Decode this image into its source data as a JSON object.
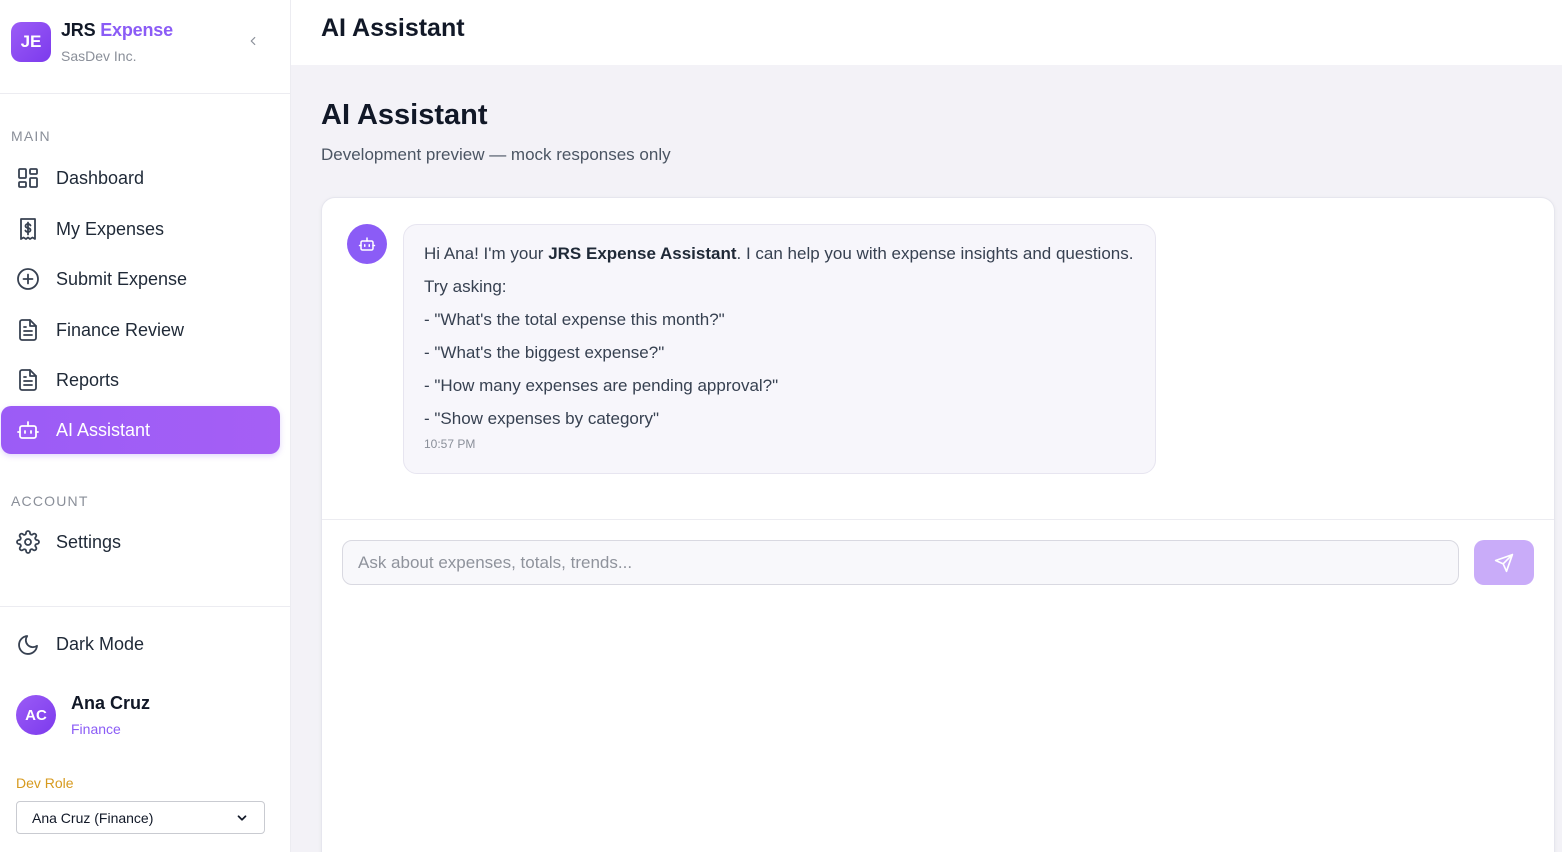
{
  "brand": {
    "initials": "JE",
    "name_part1": "JRS",
    "name_part2": "Expense",
    "company": "SasDev Inc."
  },
  "sidebar": {
    "main_label": "MAIN",
    "items": [
      {
        "label": "Dashboard",
        "icon": "dashboard-icon"
      },
      {
        "label": "My Expenses",
        "icon": "receipt-dollar-icon"
      },
      {
        "label": "Submit Expense",
        "icon": "plus-circle-icon"
      },
      {
        "label": "Finance Review",
        "icon": "document-icon"
      },
      {
        "label": "Reports",
        "icon": "document-icon"
      },
      {
        "label": "AI Assistant",
        "icon": "bot-icon",
        "active": true
      }
    ],
    "account_label": "ACCOUNT",
    "account_items": [
      {
        "label": "Settings",
        "icon": "gear-icon"
      }
    ],
    "dark_mode_label": "Dark Mode"
  },
  "user": {
    "initials": "AC",
    "name": "Ana Cruz",
    "role": "Finance"
  },
  "dev_role": {
    "label": "Dev Role",
    "selected": "Ana Cruz (Finance)"
  },
  "topbar": {
    "title": "AI Assistant"
  },
  "page": {
    "title": "AI Assistant",
    "subtitle": "Development preview — mock responses only"
  },
  "chat": {
    "message": {
      "greeting_pre": "Hi Ana! I'm your ",
      "greeting_bold": "JRS Expense Assistant",
      "greeting_post": ". I can help you with expense insights and questions.",
      "try_asking": "Try asking:",
      "suggestions": [
        "- \"What's the total expense this month?\"",
        "- \"What's the biggest expense?\"",
        "- \"How many expenses are pending approval?\"",
        "- \"Show expenses by category\""
      ],
      "time": "10:57 PM"
    },
    "input_placeholder": "Ask about expenses, totals, trends...",
    "input_value": ""
  },
  "colors": {
    "accent": "#8b5cf6",
    "send_disabled": "#c9acf9",
    "dev_role": "#d79a1e"
  }
}
